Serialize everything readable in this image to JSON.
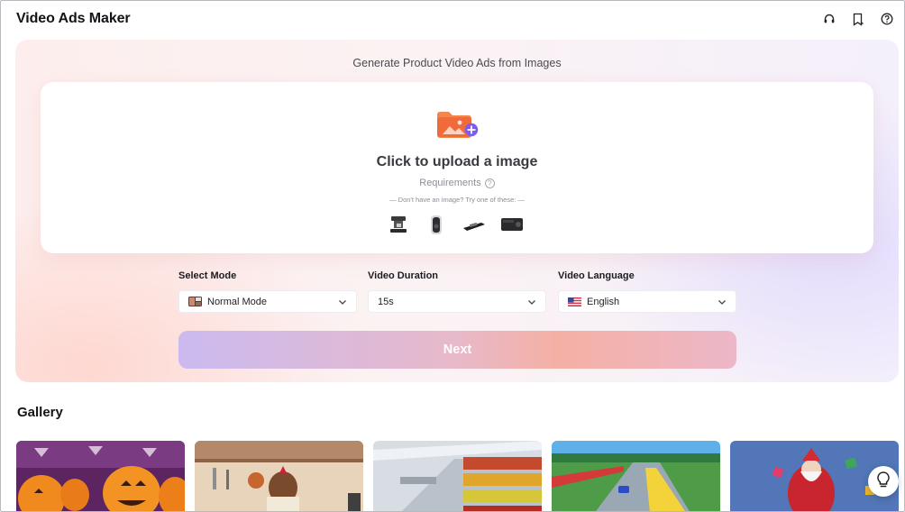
{
  "app": {
    "title": "Video Ads Maker"
  },
  "header_icons": [
    "headset-icon",
    "bookmark-icon",
    "help-circle-icon"
  ],
  "hero": {
    "title": "Generate Product Video Ads from Images",
    "upload_title": "Click to upload a image",
    "requirements": "Requirements",
    "try_hint": "— Don't have an image? Try one of these: —",
    "samples": [
      "coffee-machine-sample",
      "speaker-sample",
      "hair-tool-sample",
      "projector-sample"
    ]
  },
  "fields": {
    "mode": {
      "label": "Select Mode",
      "value": "Normal Mode"
    },
    "duration": {
      "label": "Video Duration",
      "value": "15s"
    },
    "language": {
      "label": "Video Language",
      "value": "English"
    }
  },
  "next_label": "Next",
  "gallery": {
    "title": "Gallery",
    "items": [
      "halloween-pumpkins",
      "chicken-chef-kitchen",
      "supermarket-shelves",
      "go-kart-track",
      "santa-gifts"
    ]
  },
  "colors": {
    "next_gradient_start": "#cbbaf0",
    "next_gradient_end": "#f5b0a4",
    "accent_purple": "#7e5bef",
    "folder_orange": "#f06a3c"
  }
}
